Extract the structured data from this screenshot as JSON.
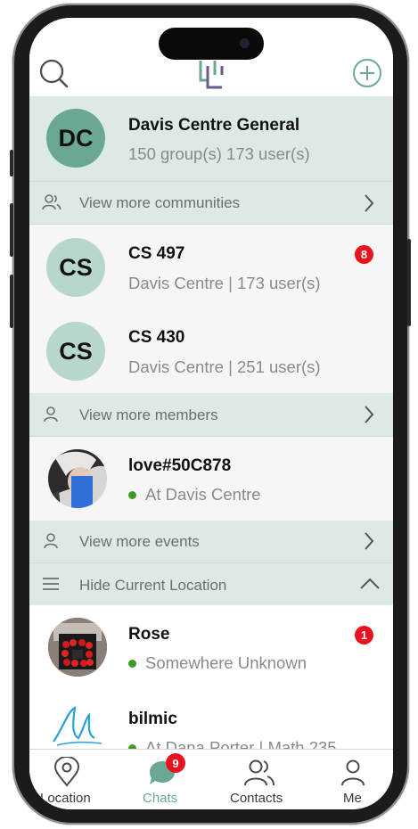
{
  "header": {
    "search_icon": "search-icon",
    "logo_icon": "app-logo",
    "add_icon": "plus-circle-icon"
  },
  "community": {
    "initials": "DC",
    "name": "Davis Centre General",
    "stats": "150 group(s) 173 user(s)"
  },
  "view_more_communities": "View more communities",
  "groups": [
    {
      "initials": "CS",
      "name": "CS 497",
      "sub": "Davis Centre | 173 user(s)",
      "badge": "8"
    },
    {
      "initials": "CS",
      "name": "CS 430",
      "sub": "Davis Centre | 251 user(s)",
      "badge": ""
    }
  ],
  "view_more_members": "View more members",
  "members": [
    {
      "name": "love#50C878",
      "status": "At Davis Centre"
    }
  ],
  "view_more_events": "View more events",
  "hide_location": "Hide Current Location",
  "chats": [
    {
      "name": "Rose",
      "status": "Somewhere Unknown",
      "badge": "1"
    },
    {
      "name": "bilmic",
      "status": "At Dana Porter | Math 235"
    }
  ],
  "tabs": [
    {
      "label": "Location",
      "icon": "location-pin-icon"
    },
    {
      "label": "Chats",
      "icon": "chat-bubble-icon",
      "badge": "9"
    },
    {
      "label": "Contacts",
      "icon": "contacts-icon"
    },
    {
      "label": "Me",
      "icon": "person-icon"
    }
  ],
  "colors": {
    "accent": "#6aa894",
    "highlight": "#dce9e4",
    "badge": "#e8131f",
    "online": "#3f9a2a"
  }
}
